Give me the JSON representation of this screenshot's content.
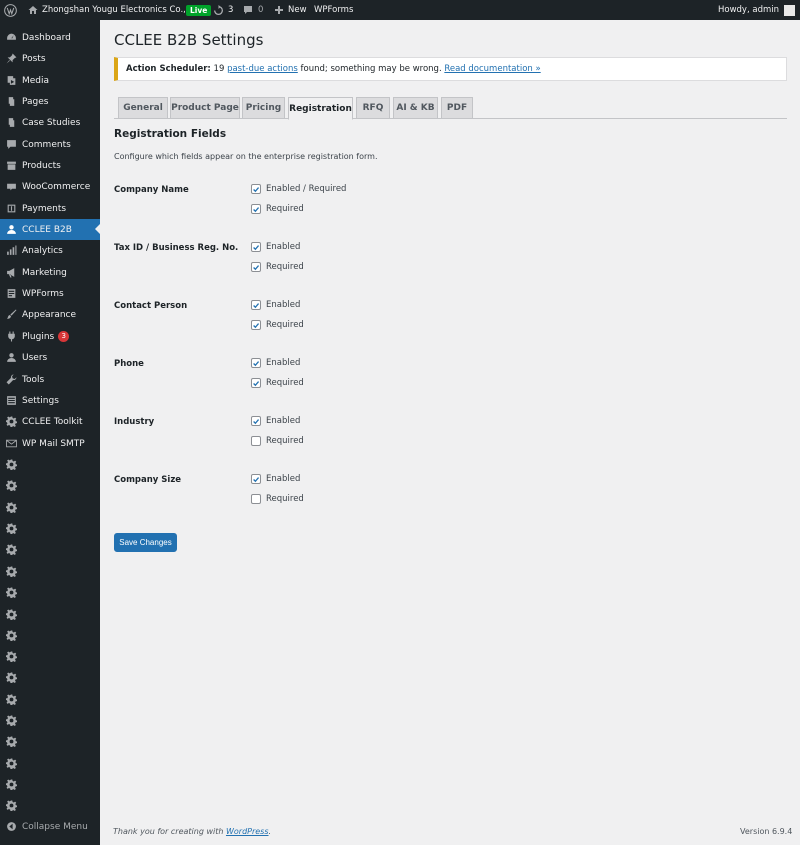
{
  "adminbar": {
    "site_name": "Zhongshan Yougu Electronics Co., Ltd.",
    "live_label": "Live",
    "updates_count": "3",
    "comments_count": "0",
    "new_label": "New",
    "wpforms_label": "WPForms",
    "howdy": "Howdy, admin"
  },
  "sidebar": {
    "items": [
      {
        "label": "Dashboard",
        "icon": "dashboard-icon"
      },
      {
        "label": "Posts",
        "icon": "pin-icon"
      },
      {
        "label": "Media",
        "icon": "media-icon"
      },
      {
        "label": "Pages",
        "icon": "pages-icon"
      },
      {
        "label": "Case Studies",
        "icon": "pages-icon"
      },
      {
        "label": "Comments",
        "icon": "comment-icon"
      },
      {
        "label": "Products",
        "icon": "archive-icon"
      },
      {
        "label": "WooCommerce",
        "icon": "woocommerce-icon"
      },
      {
        "label": "Payments",
        "icon": "payments-icon"
      },
      {
        "label": "CCLEE B2B",
        "icon": "user-icon"
      },
      {
        "label": "Analytics",
        "icon": "chart-icon"
      },
      {
        "label": "Marketing",
        "icon": "megaphone-icon"
      },
      {
        "label": "WPForms",
        "icon": "forms-icon"
      },
      {
        "label": "Appearance",
        "icon": "brush-icon"
      },
      {
        "label": "Plugins",
        "icon": "plugin-icon",
        "badge": "3"
      },
      {
        "label": "Users",
        "icon": "user-icon"
      },
      {
        "label": "Tools",
        "icon": "wrench-icon"
      },
      {
        "label": "Settings",
        "icon": "settings-icon"
      },
      {
        "label": "CCLEE Toolkit",
        "icon": "gear-icon"
      },
      {
        "label": "WP Mail SMTP",
        "icon": "mail-icon"
      }
    ],
    "collapse_label": "Collapse Menu"
  },
  "page": {
    "title": "CCLEE B2B Settings",
    "notice": {
      "strong": "Action Scheduler:",
      "text_before": " 19 ",
      "link1": "past-due actions",
      "text_after": " found; something may be wrong. ",
      "link2": "Read documentation »"
    },
    "tabs": [
      "General",
      "Product Page",
      "Pricing",
      "Registration",
      "RFQ",
      "AI & KB",
      "PDF"
    ],
    "active_tab": "Registration",
    "section_title": "Registration Fields",
    "section_desc": "Configure which fields appear on the enterprise registration form.",
    "fields": [
      {
        "label": "Company Name",
        "opt1": "Enabled / Required",
        "opt1_checked": true,
        "opt2": "Required",
        "opt2_checked": true
      },
      {
        "label": "Tax ID / Business Reg. No.",
        "opt1": "Enabled",
        "opt1_checked": true,
        "opt2": "Required",
        "opt2_checked": true
      },
      {
        "label": "Contact Person",
        "opt1": "Enabled",
        "opt1_checked": true,
        "opt2": "Required",
        "opt2_checked": true
      },
      {
        "label": "Phone",
        "opt1": "Enabled",
        "opt1_checked": true,
        "opt2": "Required",
        "opt2_checked": true
      },
      {
        "label": "Industry",
        "opt1": "Enabled",
        "opt1_checked": true,
        "opt2": "Required",
        "opt2_checked": false
      },
      {
        "label": "Company Size",
        "opt1": "Enabled",
        "opt1_checked": true,
        "opt2": "Required",
        "opt2_checked": false
      }
    ],
    "save_label": "Save Changes"
  },
  "footer": {
    "thanks": "Thank you for creating with ",
    "wp_link": "WordPress",
    "period": ".",
    "version": "Version 6.9.4"
  },
  "colors": {
    "adminbar_bg": "#1d2327",
    "accent": "#2271b1",
    "notice_warning": "#dba617",
    "live_green": "#00a32a",
    "badge_red": "#d63638"
  }
}
